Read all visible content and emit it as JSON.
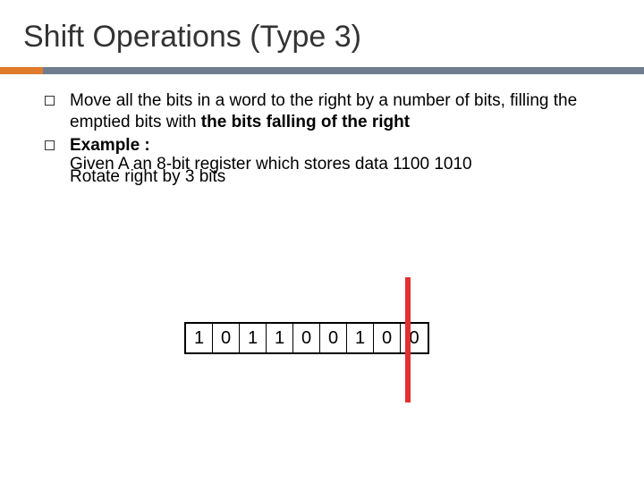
{
  "title": "Shift Operations (Type 3)",
  "bullets": {
    "item0_pre": "Move all the bits in a word to the ",
    "item0_right": "right",
    "item0_mid": " by a number of bits, filling the emptied bits with ",
    "item0_bold2": "the bits falling of the right",
    "item1_label": "Example :",
    "item1_line1": "Given A an 8-bit register which stores data 1100 1010",
    "item1_line2": "Rotate right by 3 bits"
  },
  "register": [
    "1",
    "0",
    "1",
    "1",
    "0",
    "0",
    "1",
    "0",
    "0"
  ]
}
